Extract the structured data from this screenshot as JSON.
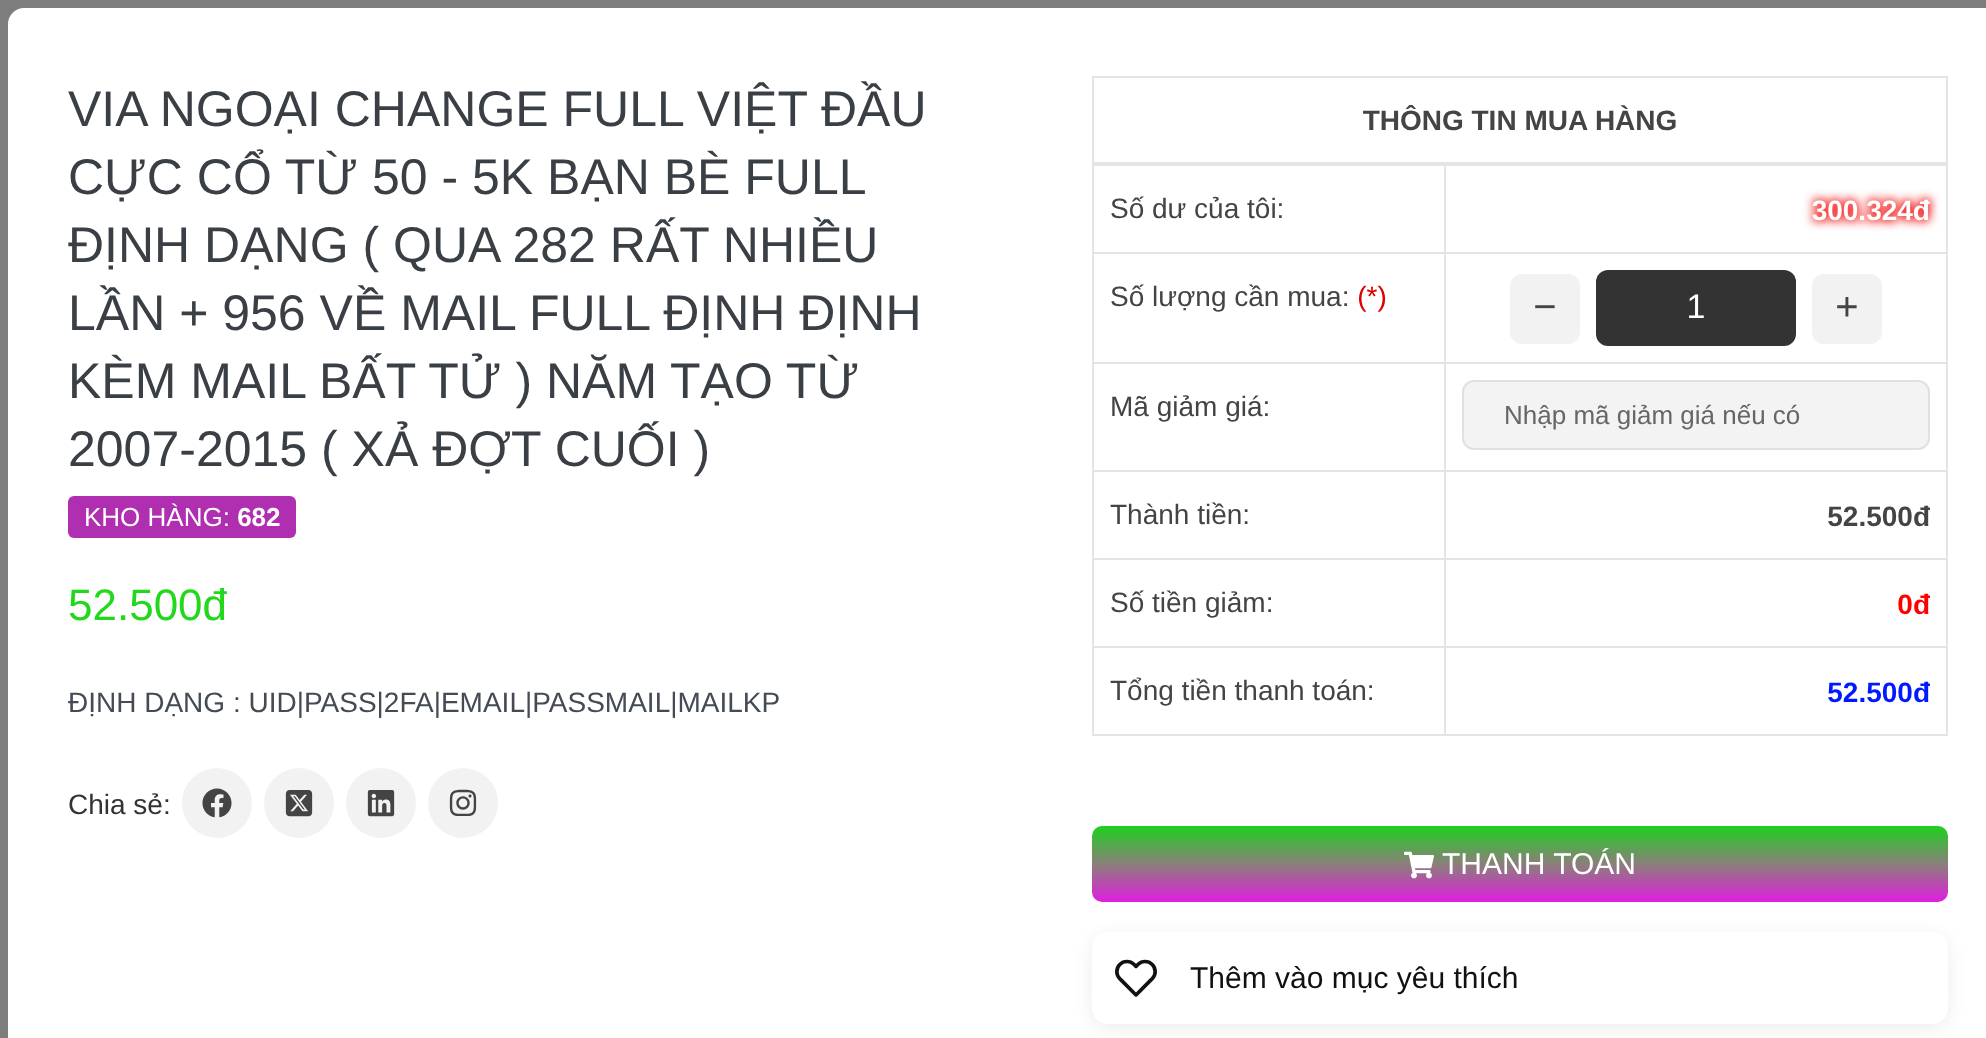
{
  "product": {
    "title": "VIA NGOẠI CHANGE FULL VIỆT ĐẦU CỰC CỔ TỪ 50 - 5K BẠN BÈ FULL ĐỊNH DẠNG ( QUA 282 RẤT NHIỀU LẦN + 956 VỀ MAIL FULL ĐỊNH ĐỊNH KÈM MAIL BẤT TỬ ) NĂM TẠO TỪ 2007-2015 ( XẢ ĐỢT CUỐI )",
    "stock_badge": "KHO HÀNG: **682**",
    "price": "52.500đ",
    "format": "ĐỊNH DẠNG : UID|PASS|2FA|EMAIL|PASSMAIL|MAILKP"
  },
  "share": {
    "label": "Chia sẻ:",
    "buttons": [
      {
        "kind": "facebook"
      },
      {
        "kind": "x"
      },
      {
        "kind": "linkedin"
      },
      {
        "kind": "instagram"
      }
    ]
  },
  "purchase": {
    "title": "THÔNG TIN MUA HÀNG",
    "rows": [
      {
        "kind": "balance",
        "label": "Số dư của tôi:",
        "value": "300.324đ",
        "color": "#ffffff"
      },
      {
        "kind": "quantity",
        "label": "Số lượng cần mua:",
        "required": "(*)",
        "minus": "−",
        "value": "1",
        "plus": "+"
      },
      {
        "kind": "input",
        "label": "Mã giảm giá:",
        "placeholder": "Nhập mã giảm giá nếu có"
      },
      {
        "kind": "value",
        "label": "Thành tiền:",
        "value": "52.500đ",
        "color": "#444444"
      },
      {
        "kind": "value",
        "label": "Số tiền giảm:",
        "value": "0đ",
        "color": "#ff0000"
      },
      {
        "kind": "value",
        "label": "Tổng tiền thanh toán:",
        "value": "52.500đ",
        "color": "#0019ff"
      }
    ]
  },
  "checkout_button": "THANH TOÁN",
  "wishlist": "Thêm vào mục yêu thích"
}
